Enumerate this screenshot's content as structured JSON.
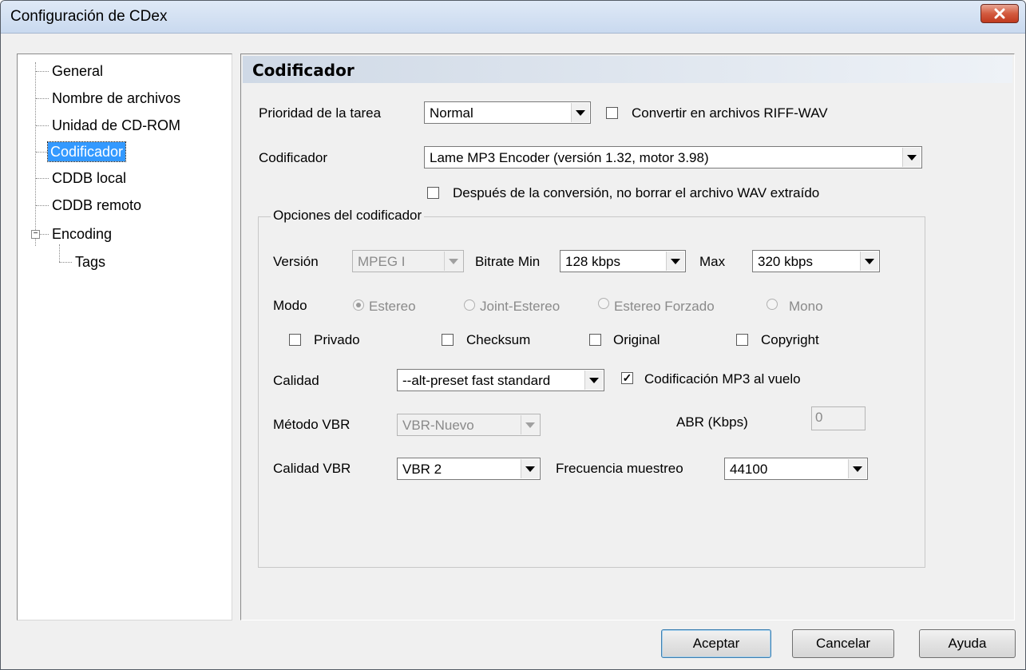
{
  "window": {
    "title": "Configuración de CDex"
  },
  "tree": {
    "items": [
      "General",
      "Nombre de archivos",
      "Unidad de CD-ROM",
      "Codificador",
      "CDDB local",
      "CDDB remoto",
      "Encoding",
      "Tags"
    ],
    "selected": "Codificador"
  },
  "panel": {
    "header": "Codificador"
  },
  "form": {
    "priority_label": "Prioridad de la tarea",
    "priority_value": "Normal",
    "riff_wav_label": "Convertir en archivos RIFF-WAV",
    "riff_wav_checked": false,
    "encoder_label": "Codificador",
    "encoder_value": "Lame MP3 Encoder (versión 1.32, motor 3.98)",
    "keep_wav_label": "Después de la conversión, no borrar el archivo WAV extraído",
    "keep_wav_checked": false
  },
  "options": {
    "group_title": "Opciones del codificador",
    "version_label": "Versión",
    "version_value": "MPEG I",
    "bitrate_min_label": "Bitrate Min",
    "bitrate_min_value": "128 kbps",
    "max_label": "Max",
    "max_value": "320 kbps",
    "mode_label": "Modo",
    "modes": [
      "Estereo",
      "Joint-Estereo",
      "Estereo Forzado",
      "Mono"
    ],
    "mode_selected": "Estereo",
    "flags": [
      "Privado",
      "Checksum",
      "Original",
      "Copyright"
    ],
    "quality_label": "Calidad",
    "quality_value": "--alt-preset fast standard",
    "onthefly_label": "Codificación MP3 al vuelo",
    "onthefly_checked": true,
    "vbr_method_label": "Método VBR",
    "vbr_method_value": "VBR-Nuevo",
    "abr_label": "ABR (Kbps)",
    "abr_value": "0",
    "vbr_quality_label": "Calidad VBR",
    "vbr_quality_value": "VBR 2",
    "sample_rate_label": "Frecuencia muestreo",
    "sample_rate_value": "44100"
  },
  "buttons": {
    "ok": "Aceptar",
    "cancel": "Cancelar",
    "help": "Ayuda"
  },
  "colors": {
    "selection": "#3399ff",
    "close_button": "#c7432a"
  }
}
